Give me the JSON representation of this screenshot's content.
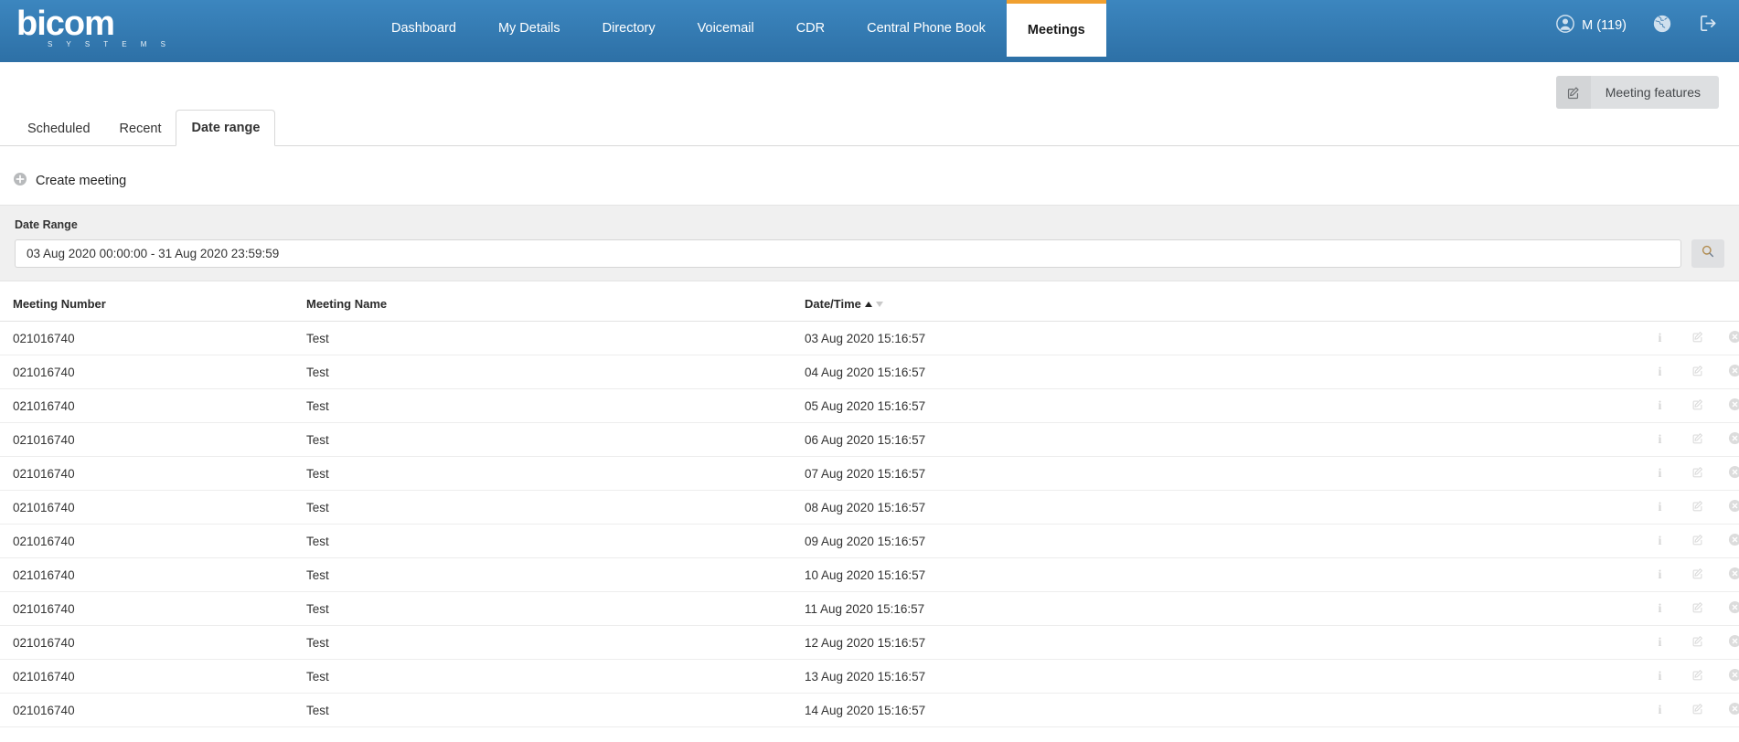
{
  "header": {
    "logo_word": "bicom",
    "logo_sub": "S Y S T E M S",
    "nav": [
      {
        "label": "Dashboard",
        "active": false
      },
      {
        "label": "My Details",
        "active": false
      },
      {
        "label": "Directory",
        "active": false
      },
      {
        "label": "Voicemail",
        "active": false
      },
      {
        "label": "CDR",
        "active": false
      },
      {
        "label": "Central Phone Book",
        "active": false
      },
      {
        "label": "Meetings",
        "active": true
      }
    ],
    "user_label": "M (119)",
    "user_icon": "user-circle-icon",
    "language_icon": "globe-icon",
    "logout_icon": "logout-icon",
    "active_tab_accent": "#f0a030",
    "bar_color_top": "#3c86bf",
    "bar_color_bottom": "#2d70a6"
  },
  "toolbar": {
    "features_label": "Meeting features",
    "features_icon": "edit-square-icon"
  },
  "subtabs": [
    {
      "label": "Scheduled",
      "active": false
    },
    {
      "label": "Recent",
      "active": false
    },
    {
      "label": "Date range",
      "active": true
    }
  ],
  "create": {
    "label": "Create meeting",
    "icon": "plus-circle-icon"
  },
  "filter": {
    "label": "Date Range",
    "value": "03 Aug 2020 00:00:00 - 31 Aug 2020 23:59:59",
    "placeholder": "03 Aug 2020 00:00:00 - 31 Aug 2020 23:59:59",
    "search_icon": "search-icon"
  },
  "table": {
    "columns": [
      {
        "label": "Meeting Number"
      },
      {
        "label": "Meeting Name"
      },
      {
        "label": "Date/Time"
      }
    ],
    "sort": {
      "column": "Date/Time",
      "direction": "ascending"
    },
    "row_actions": [
      {
        "icon": "info-icon",
        "label": "i"
      },
      {
        "icon": "edit-square-icon",
        "label": ""
      },
      {
        "icon": "delete-circle-icon",
        "label": ""
      }
    ],
    "rows": [
      {
        "number": "021016740",
        "name": "Test",
        "datetime": "03 Aug 2020 15:16:57"
      },
      {
        "number": "021016740",
        "name": "Test",
        "datetime": "04 Aug 2020 15:16:57"
      },
      {
        "number": "021016740",
        "name": "Test",
        "datetime": "05 Aug 2020 15:16:57"
      },
      {
        "number": "021016740",
        "name": "Test",
        "datetime": "06 Aug 2020 15:16:57"
      },
      {
        "number": "021016740",
        "name": "Test",
        "datetime": "07 Aug 2020 15:16:57"
      },
      {
        "number": "021016740",
        "name": "Test",
        "datetime": "08 Aug 2020 15:16:57"
      },
      {
        "number": "021016740",
        "name": "Test",
        "datetime": "09 Aug 2020 15:16:57"
      },
      {
        "number": "021016740",
        "name": "Test",
        "datetime": "10 Aug 2020 15:16:57"
      },
      {
        "number": "021016740",
        "name": "Test",
        "datetime": "11 Aug 2020 15:16:57"
      },
      {
        "number": "021016740",
        "name": "Test",
        "datetime": "12 Aug 2020 15:16:57"
      },
      {
        "number": "021016740",
        "name": "Test",
        "datetime": "13 Aug 2020 15:16:57"
      },
      {
        "number": "021016740",
        "name": "Test",
        "datetime": "14 Aug 2020 15:16:57"
      }
    ]
  }
}
